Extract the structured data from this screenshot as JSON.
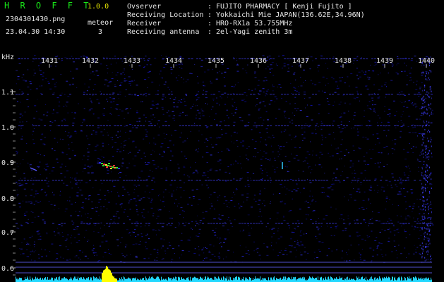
{
  "app": {
    "name": "H R O F F T",
    "version": "1.0.0"
  },
  "file": {
    "name": "2304301430.png",
    "datetime": "23.04.30 14:30"
  },
  "meteor": {
    "label": "meteor",
    "count": "3"
  },
  "info": [
    {
      "label": "Ovserver",
      "value": "FUJITO PHARMACY [ Kenji Fujito ]"
    },
    {
      "label": "Receiving Location",
      "value": "Yokkaichi Mie JAPAN(136.62E,34.96N)"
    },
    {
      "label": "Receiver",
      "value": "HRO-RX1a 53.755MHz"
    },
    {
      "label": "Receiving antenna",
      "value": "2el-Yagi zenith 3m"
    }
  ],
  "axes": {
    "y_unit": "kHz",
    "y_ticks": [
      "1.1",
      "1.0",
      "0.9",
      "0.8",
      "0.7",
      "0.6"
    ],
    "x_ticks": [
      "1431",
      "1432",
      "1433",
      "1434",
      "1435",
      "1436",
      "1437",
      "1438",
      "1439",
      "1440"
    ]
  },
  "colors": {
    "background": "#000000",
    "noise": "#1a1aa8",
    "tick_label": "#e6e6e6",
    "title_green": "#19e619",
    "meteor_head": "#ff3030",
    "meteor_mid": "#30e030",
    "spectrum": "#22d8ff",
    "spectrum_peak": "#ffff00"
  }
}
